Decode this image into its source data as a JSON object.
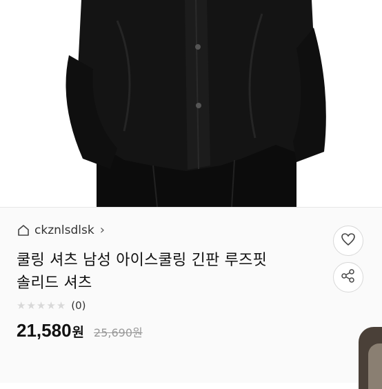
{
  "store": {
    "name": "ckznlsdlsk",
    "home_icon": "home-icon",
    "chevron": "›"
  },
  "product": {
    "title_line1": "쿨링 셔츠 남성 아이스쿨링 긴판 루즈핏",
    "title_line2": "솔리드 셔츠",
    "review_count": "(0)",
    "rating": 0,
    "rating_max": 5,
    "sale_price": "21,580",
    "sale_unit": "원",
    "original_price": "25,690원"
  },
  "actions": {
    "like_icon": "heart-icon",
    "share_icon": "share-icon"
  },
  "colors": {
    "garment": "#111111",
    "star_empty": "#d8d8d8",
    "original_price": "#999999"
  }
}
